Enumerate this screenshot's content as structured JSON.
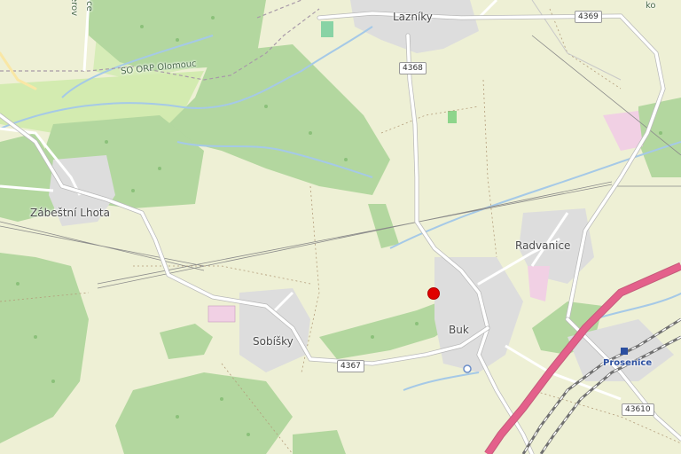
{
  "places": {
    "lazniky": "Lazníky",
    "zabestni_lhota": "Zábeštní Lhota",
    "radvanice": "Radvanice",
    "sobisky": "Sobíšky",
    "buk": "Buk",
    "prosenice": "Prosenice"
  },
  "roads": {
    "r4369": "4369",
    "r4368": "4368",
    "r4367": "4367",
    "r43610": "43610"
  },
  "boundary_label": "SO ORP Olomouc",
  "edge_text": {
    "top_left_a": "erov",
    "top_left_b": "ce",
    "top_right": "ko"
  },
  "marker": {
    "color": "#e00000"
  },
  "colors": {
    "land": "#eef0d5",
    "forest": "#b0d69c",
    "forest_dark": "#8ac27c",
    "residential": "#e0dfdf",
    "water": "#a5c9e7",
    "road": "#ffffff",
    "railway_highspeed": "#e4608b"
  }
}
